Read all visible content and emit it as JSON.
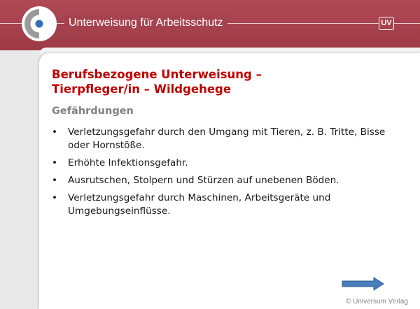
{
  "header": {
    "title": "Unterweisung für Arbeitsschutz",
    "brand_badge": "UV",
    "colors": {
      "header_bg": "#a6424e",
      "logo_blue": "#2f6fb5",
      "logo_gray": "#9a9a9a"
    }
  },
  "slide": {
    "title_line1": "Berufsbezogene Unterweisung –",
    "title_line2": "Tierpfleger/in – Wildgehege",
    "section_heading": "Gefährdungen",
    "items": [
      "Verletzungsgefahr durch den Umgang mit Tieren, z. B. Tritte, Bisse oder Hornstöße.",
      "Erhöhte Infektionsgefahr.",
      "Ausrutschen, Stolpern und Stürzen auf unebenen Böden.",
      "Verletzungsgefahr durch Maschinen, Arbeitsgeräte und Umgebungseinflüsse."
    ],
    "colors": {
      "title": "#c00000",
      "heading": "#808080",
      "arrow": "#4a7ebb"
    }
  },
  "footer": {
    "next_icon": "arrow-right-icon",
    "copyright": "© Universum Verlag"
  }
}
